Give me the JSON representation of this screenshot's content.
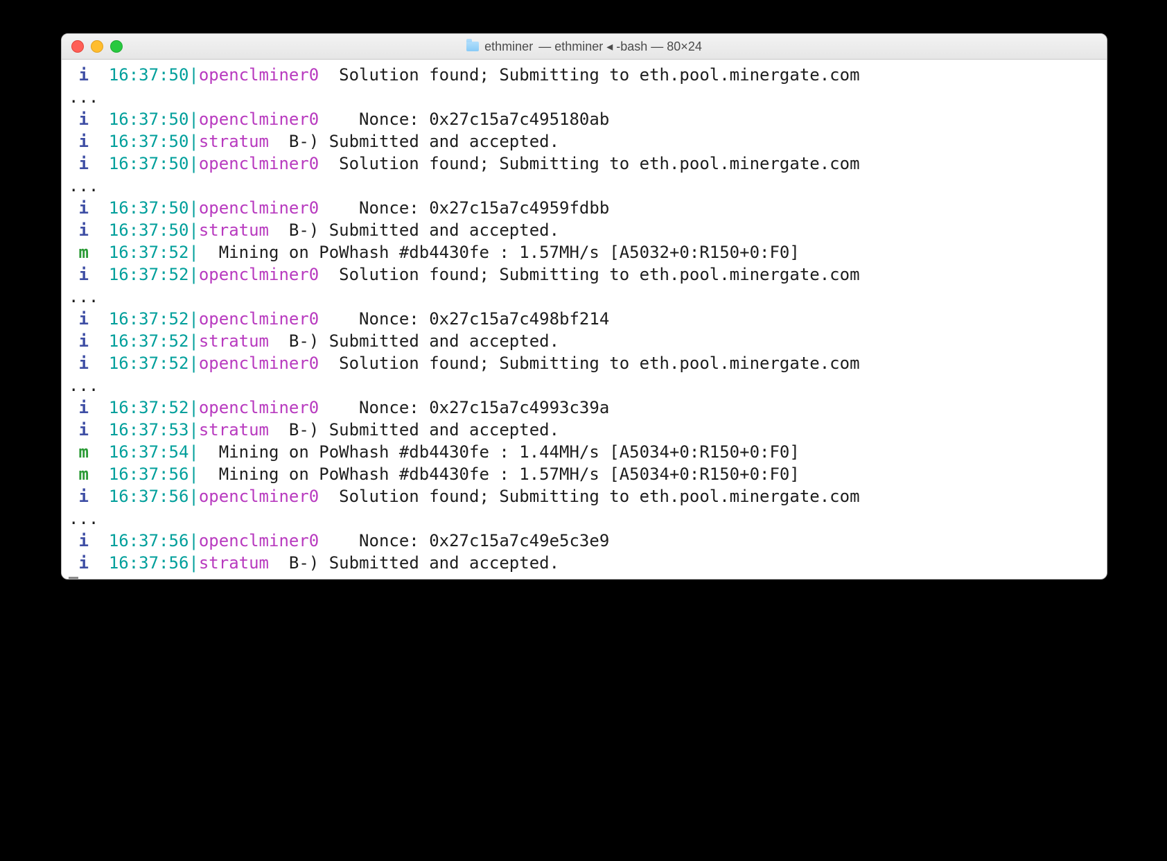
{
  "window": {
    "title_folder_name": "ethminer",
    "title_suffix": "— ethminer ◂ -bash — 80×24"
  },
  "lines": [
    {
      "kind": "log",
      "level": "i",
      "ts": "16:37:50",
      "src": "openclminer0",
      "pad": "  ",
      "msg": "Solution found; Submitting to eth.pool.minergate.com"
    },
    {
      "kind": "dots",
      "text": "..."
    },
    {
      "kind": "log",
      "level": "i",
      "ts": "16:37:50",
      "src": "openclminer0",
      "pad": "    ",
      "msg": "Nonce: 0x27c15a7c495180ab"
    },
    {
      "kind": "log",
      "level": "i",
      "ts": "16:37:50",
      "src": "stratum",
      "pad": "  ",
      "msg": "B-) Submitted and accepted."
    },
    {
      "kind": "log",
      "level": "i",
      "ts": "16:37:50",
      "src": "openclminer0",
      "pad": "  ",
      "msg": "Solution found; Submitting to eth.pool.minergate.com"
    },
    {
      "kind": "dots",
      "text": "..."
    },
    {
      "kind": "log",
      "level": "i",
      "ts": "16:37:50",
      "src": "openclminer0",
      "pad": "    ",
      "msg": "Nonce: 0x27c15a7c4959fdbb"
    },
    {
      "kind": "log",
      "level": "i",
      "ts": "16:37:50",
      "src": "stratum",
      "pad": "  ",
      "msg": "B-) Submitted and accepted."
    },
    {
      "kind": "log",
      "level": "m",
      "ts": "16:37:52",
      "src": "",
      "pad": "  ",
      "msg": "Mining on PoWhash #db4430fe : 1.57MH/s [A5032+0:R150+0:F0]"
    },
    {
      "kind": "log",
      "level": "i",
      "ts": "16:37:52",
      "src": "openclminer0",
      "pad": "  ",
      "msg": "Solution found; Submitting to eth.pool.minergate.com"
    },
    {
      "kind": "dots",
      "text": "..."
    },
    {
      "kind": "log",
      "level": "i",
      "ts": "16:37:52",
      "src": "openclminer0",
      "pad": "    ",
      "msg": "Nonce: 0x27c15a7c498bf214"
    },
    {
      "kind": "log",
      "level": "i",
      "ts": "16:37:52",
      "src": "stratum",
      "pad": "  ",
      "msg": "B-) Submitted and accepted."
    },
    {
      "kind": "log",
      "level": "i",
      "ts": "16:37:52",
      "src": "openclminer0",
      "pad": "  ",
      "msg": "Solution found; Submitting to eth.pool.minergate.com"
    },
    {
      "kind": "dots",
      "text": "..."
    },
    {
      "kind": "log",
      "level": "i",
      "ts": "16:37:52",
      "src": "openclminer0",
      "pad": "    ",
      "msg": "Nonce: 0x27c15a7c4993c39a"
    },
    {
      "kind": "log",
      "level": "i",
      "ts": "16:37:53",
      "src": "stratum",
      "pad": "  ",
      "msg": "B-) Submitted and accepted."
    },
    {
      "kind": "log",
      "level": "m",
      "ts": "16:37:54",
      "src": "",
      "pad": "  ",
      "msg": "Mining on PoWhash #db4430fe : 1.44MH/s [A5034+0:R150+0:F0]"
    },
    {
      "kind": "log",
      "level": "m",
      "ts": "16:37:56",
      "src": "",
      "pad": "  ",
      "msg": "Mining on PoWhash #db4430fe : 1.57MH/s [A5034+0:R150+0:F0]"
    },
    {
      "kind": "log",
      "level": "i",
      "ts": "16:37:56",
      "src": "openclminer0",
      "pad": "  ",
      "msg": "Solution found; Submitting to eth.pool.minergate.com"
    },
    {
      "kind": "dots",
      "text": "..."
    },
    {
      "kind": "log",
      "level": "i",
      "ts": "16:37:56",
      "src": "openclminer0",
      "pad": "    ",
      "msg": "Nonce: 0x27c15a7c49e5c3e9"
    },
    {
      "kind": "log",
      "level": "i",
      "ts": "16:37:56",
      "src": "stratum",
      "pad": "  ",
      "msg": "B-) Submitted and accepted."
    }
  ]
}
